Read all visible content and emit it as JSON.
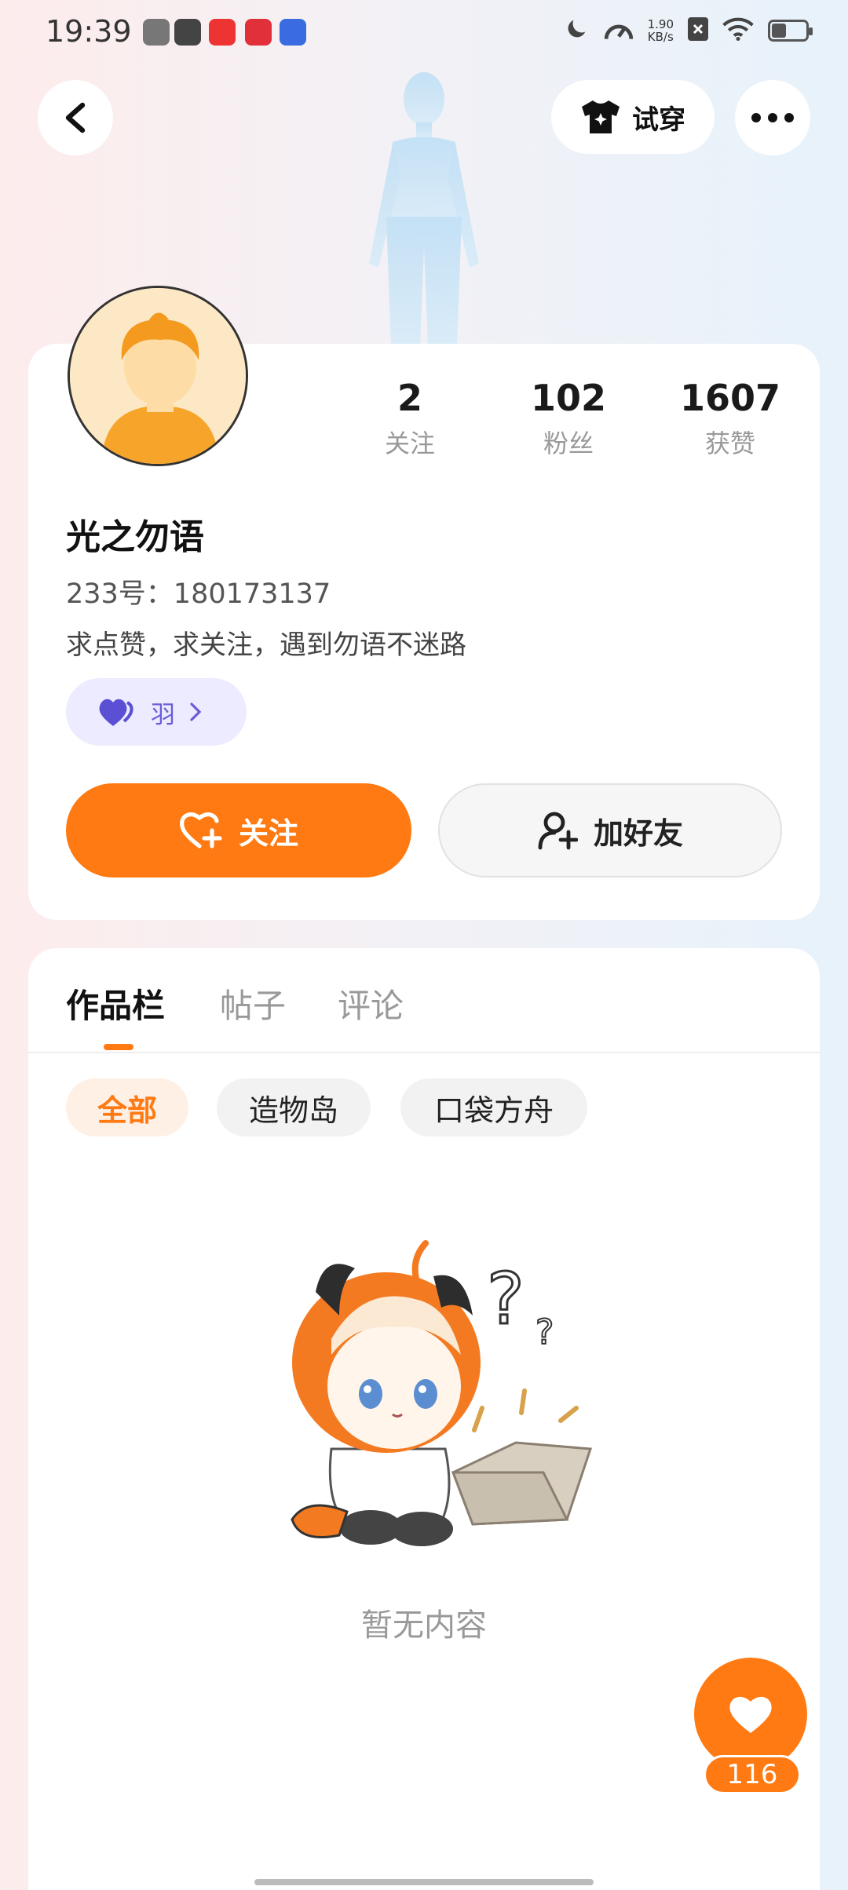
{
  "status_bar": {
    "time": "19:39",
    "net_speed_value": "1.90",
    "net_speed_unit": "KB/s"
  },
  "top_bar": {
    "try_on_label": "试穿"
  },
  "profile": {
    "username": "光之勿语",
    "user_id": "233号：180173137",
    "bio": "求点赞，求关注，遇到勿语不迷路",
    "tag_label": "羽",
    "stats": [
      {
        "value": "2",
        "label": "关注"
      },
      {
        "value": "102",
        "label": "粉丝"
      },
      {
        "value": "1607",
        "label": "获赞"
      }
    ],
    "follow_label": "关注",
    "add_friend_label": "加好友"
  },
  "content": {
    "tabs": [
      {
        "label": "作品栏",
        "active": true
      },
      {
        "label": "帖子",
        "active": false
      },
      {
        "label": "评论",
        "active": false
      }
    ],
    "filters": [
      {
        "label": "全部",
        "active": true
      },
      {
        "label": "造物岛",
        "active": false
      },
      {
        "label": "口袋方舟",
        "active": false
      }
    ],
    "empty_text": "暂无内容"
  },
  "like_fab": {
    "count": "116"
  },
  "colors": {
    "accent": "#ff7a12",
    "tag_purple": "#6a5cd9"
  }
}
